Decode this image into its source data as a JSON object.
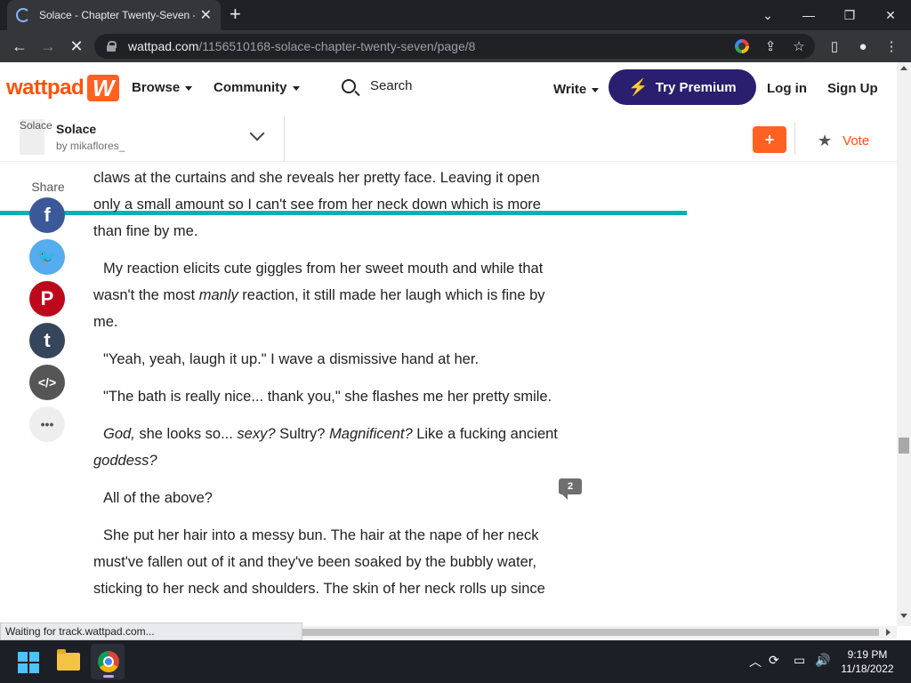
{
  "browser": {
    "tab_title": "Solace - Chapter Twenty-Seven -",
    "url_host": "wattpad.com",
    "url_path": "/1156510168-solace-chapter-twenty-seven/page/8",
    "status_text": "Waiting for track.wattpad.com..."
  },
  "header": {
    "logo_text": "wattpad",
    "logo_mark": "W",
    "browse": "Browse",
    "community": "Community",
    "search": "Search",
    "write": "Write",
    "premium": "Try Premium",
    "login": "Log in",
    "signup": "Sign Up"
  },
  "story": {
    "cover_alt": "Solace",
    "title": "Solace",
    "author": "by mikaflores_",
    "add": "+",
    "vote": "Vote",
    "reading_progress": 0.766
  },
  "share": {
    "label": "Share",
    "buttons": [
      {
        "name": "facebook",
        "glyph": "f",
        "color": "#3b5998"
      },
      {
        "name": "twitter",
        "glyph": "🐦",
        "color": "#55acee"
      },
      {
        "name": "pinterest",
        "glyph": "P",
        "color": "#bd081c"
      },
      {
        "name": "tumblr",
        "glyph": "t",
        "color": "#35465c"
      },
      {
        "name": "embed",
        "glyph": "</>",
        "color": "#555555"
      },
      {
        "name": "more",
        "glyph": "•••",
        "color": "#eeeeee"
      }
    ]
  },
  "content": {
    "p1": "claws at the curtains and she reveals her pretty face. Leaving it open only a small amount so I can't see from her neck down which is more than fine by me.",
    "p2a": "My reaction elicits cute giggles from her sweet mouth and while that wasn't the most ",
    "p2i": "manly",
    "p2b": " reaction, it still made her laugh which is fine by me.",
    "p3": "\"Yeah, yeah, laugh it up.\" I wave a dismissive hand at her.",
    "p4": "\"The bath is really nice... thank you,\" she flashes me her pretty smile.",
    "p5_1": "God,",
    "p5_2": " she looks so... ",
    "p5_3": "sexy?",
    "p5_4": " Sultry? ",
    "p5_5": "Magnificent?",
    "p5_6": " Like a fucking ancient ",
    "p5_7": "goddess?",
    "p6": "All of the above?",
    "p7": "She put her hair into a messy bun. The hair at the nape of her neck must've fallen out of it and they've been soaked by the bubbly water, sticking to her neck and shoulders. The skin of her neck rolls up since",
    "comment_count": "2"
  },
  "taskbar": {
    "time": "9:19 PM",
    "date": "11/18/2022"
  }
}
